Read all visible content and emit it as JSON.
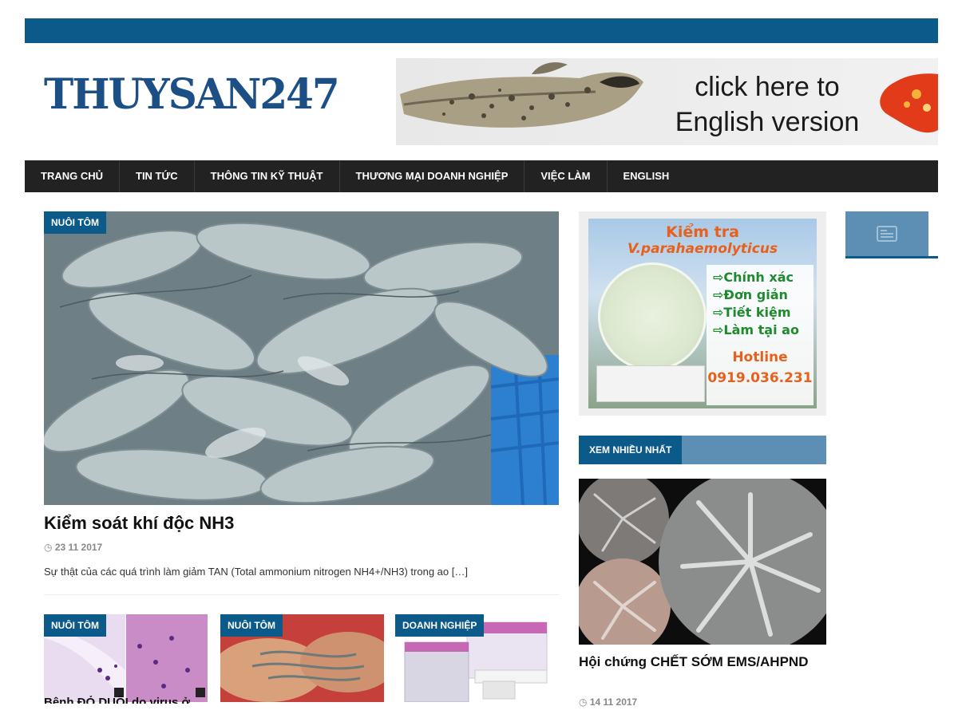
{
  "site": {
    "logo_text": "THUYSAN247"
  },
  "banner": {
    "line1": "click here to",
    "line2": "English version"
  },
  "nav": {
    "items": [
      "TRANG CHỦ",
      "TIN TỨC",
      "THÔNG TIN KỸ THUẬT",
      "THƯƠNG MẠI DOANH NGHIỆP",
      "VIỆC LÀM",
      "ENGLISH"
    ]
  },
  "featured": {
    "category": "NUÔI TÔM",
    "title": "Kiểm soát khí độc NH3",
    "date": "23 11 2017",
    "excerpt": "Sự thật của các quá trình làm giảm TAN (Total ammonium nitrogen NH4+/NH3) trong ao […]"
  },
  "grid_posts": [
    {
      "category": "NUÔI TÔM",
      "title": "Bệnh ĐỎ DUÔI do virus ở"
    },
    {
      "category": "NUÔI TÔM"
    },
    {
      "category": "DOANH NGHIỆP"
    }
  ],
  "ad": {
    "title1": "Kiểm tra",
    "title2": "V.parahaemolyticus",
    "bullets": [
      "⇨Chính xác",
      "⇨Đơn giản",
      "⇨Tiết kiệm",
      "⇨Làm tại ao"
    ],
    "hotline_label": "Hotline",
    "hotline_number": "0919.036.231"
  },
  "popular": {
    "heading": "XEM NHIỀU NHẤT",
    "title": "Hội chứng CHẾT SỚM EMS/AHPND",
    "date": "14 11 2017"
  },
  "icons": {
    "date": "clock-icon",
    "tab": "newspaper-icon"
  },
  "colors": {
    "brand": "#0c5a8a",
    "nav_bg": "#222222",
    "accent_light": "#5c8fb3",
    "ad_orange": "#e8601c",
    "ad_green": "#1f8a2c"
  }
}
